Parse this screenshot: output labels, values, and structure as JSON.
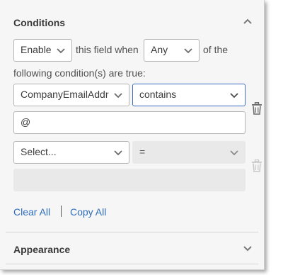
{
  "conditions": {
    "header_title": "Conditions",
    "action_select_value": "Enable",
    "text_this_field_when": "this field when",
    "match_select_value": "Any",
    "text_of_the": "of the",
    "text_following": "following condition(s) are true:",
    "rule1": {
      "field_value": "CompanyEmailAddr",
      "operator_value": "contains",
      "value_text": "@"
    },
    "rule2": {
      "field_placeholder": "Select...",
      "operator_value": "=",
      "value_text": ""
    },
    "clear_all_label": "Clear All",
    "copy_all_label": "Copy All"
  },
  "appearance": {
    "header_title": "Appearance"
  },
  "colors": {
    "link": "#2f6dbd",
    "focus_border": "#3c6cbf",
    "panel_bg": "#f6f6f6",
    "disabled_bg": "#e9e9e9"
  },
  "icons": [
    "chevron-up-icon",
    "chevron-down-icon",
    "trash-icon"
  ]
}
